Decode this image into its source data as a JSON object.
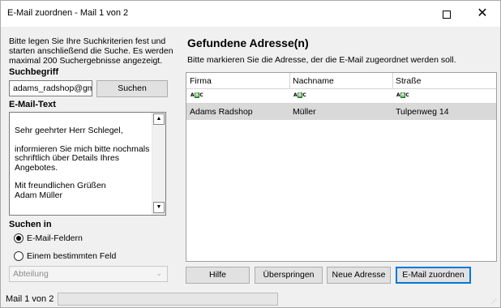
{
  "window": {
    "title": "E-Mail zuordnen - Mail 1 von 2",
    "maximize_icon": "maximize-icon",
    "close_icon": "close-icon"
  },
  "left": {
    "instructions": "Bitte legen Sie Ihre Suchkriterien fest und starten anschließend die Suche. Es werden maximal 200 Suchergebnisse angezeigt.",
    "search_label": "Suchbegriff",
    "search_value": "adams_radshop@gm",
    "search_button": "Suchen",
    "email_text_label": "E-Mail-Text",
    "email_text": {
      "greeting": "Sehr geehrter Herr Schlegel,",
      "body": "informieren Sie mich bitte nochmals schriftlich über Details Ihres Angebotes.",
      "closing": "Mit freundlichen Grüßen",
      "signature": "Adam Müller"
    },
    "search_in_label": "Suchen in",
    "radio_options": [
      "E-Mail-Feldern",
      "Einem bestimmten Feld"
    ],
    "radio_selected": 0,
    "field_select": "Abteilung"
  },
  "main": {
    "heading": "Gefundene Adresse(n)",
    "subtitle": "Bitte markieren Sie die Adresse, der die E-Mail zugeordnet werden soll.",
    "columns": [
      "Firma",
      "Nachname",
      "Straße"
    ],
    "filter_icon": "abc-filter-icon",
    "rows": [
      {
        "firma": "Adams Radshop",
        "nachname": "Müller",
        "strasse": "Tulpenweg 14"
      }
    ],
    "buttons": {
      "help": "Hilfe",
      "skip": "Überspringen",
      "new_address": "Neue Adresse",
      "assign": "E-Mail zuordnen"
    }
  },
  "status": {
    "text": "Mail 1 von 2",
    "progress": 0.0
  }
}
